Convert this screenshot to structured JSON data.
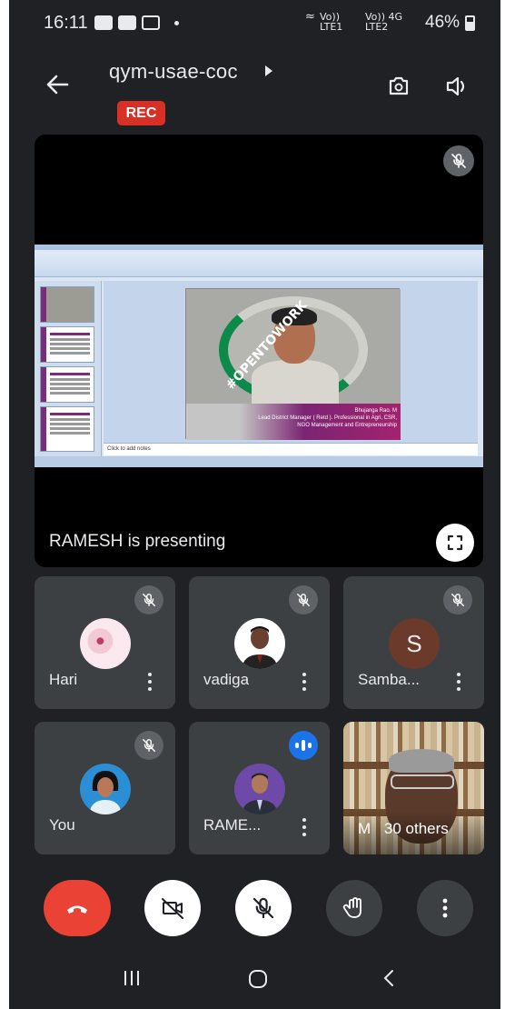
{
  "status_bar": {
    "time": "16:11",
    "network_1": "Vo)) LTE1",
    "network_2": "Vo)) 4G LTE2",
    "battery": "46%"
  },
  "header": {
    "meeting_code": "qym-usae-coc",
    "rec_label": "REC"
  },
  "presentation": {
    "presenter_label": "RAMESH is presenting",
    "slide_caption_line1": "Bhujanga Rao. M",
    "slide_caption_line2": "Lead District Manager ( Retd ). Professional in Agri, CSR,",
    "slide_caption_line3": "NGO Management and Entrepreneurship",
    "slide_badge": "#OPENTOWORK",
    "notes_placeholder": "Click to add notes"
  },
  "participants": [
    {
      "name": "Hari",
      "muted": true
    },
    {
      "name": "vadiga",
      "muted": true
    },
    {
      "name": "Samba...",
      "initial": "S",
      "muted": true
    },
    {
      "name": "You",
      "muted": true
    },
    {
      "name": "RAME...",
      "speaking": true
    }
  ],
  "others_tile": {
    "initial": "M",
    "label": "30 others"
  },
  "colors": {
    "background": "#202124",
    "tile": "#3c4043",
    "end_call": "#ea4335",
    "rec": "#d93025",
    "speaking": "#1a73e8"
  },
  "icons": [
    "back-arrow-icon",
    "switch-camera-icon",
    "speaker-icon",
    "mic-off-icon",
    "fullscreen-icon",
    "more-vert-icon",
    "end-call-icon",
    "camera-off-icon",
    "hand-raise-icon",
    "recents-icon",
    "home-icon",
    "nav-back-icon"
  ]
}
